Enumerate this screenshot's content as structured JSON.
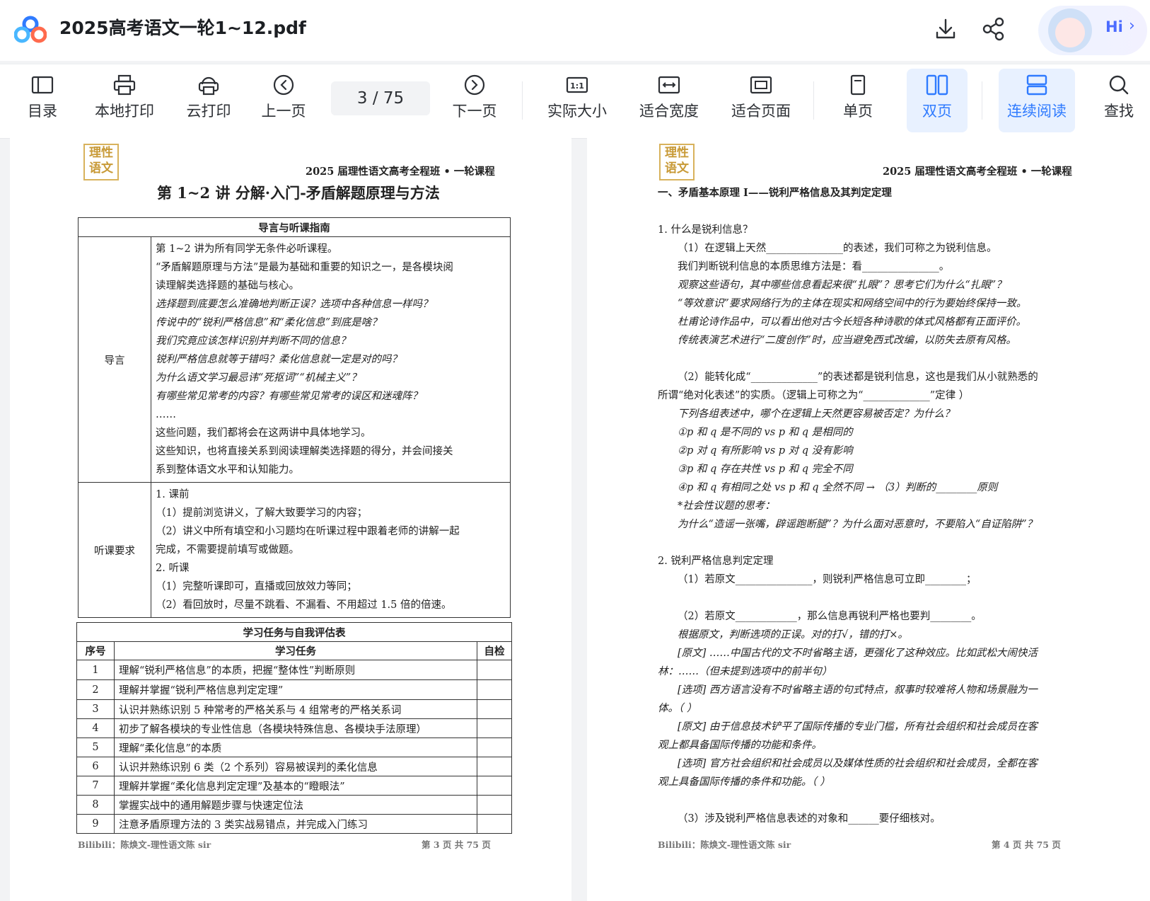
{
  "app": {
    "file_title": "2025高考语文一轮1~12.pdf",
    "hi_label": "Hi",
    "accent": "#2f7bff"
  },
  "toolbar": {
    "tools_left": [
      {
        "label": "目录",
        "icon": "toc-icon"
      },
      {
        "label": "本地打印",
        "icon": "printer-icon"
      },
      {
        "label": "云打印",
        "icon": "cloud-print-icon"
      },
      {
        "label": "上一页",
        "icon": "prev-page-icon"
      }
    ],
    "page_current": "3",
    "page_total": "/ 75",
    "tools_right": [
      {
        "label": "下一页",
        "icon": "next-page-icon"
      },
      {
        "label": "实际大小",
        "icon": "actual-size-icon"
      },
      {
        "label": "适合宽度",
        "icon": "fit-width-icon"
      },
      {
        "label": "适合页面",
        "icon": "fit-page-icon"
      },
      {
        "label": "单页",
        "icon": "single-page-icon"
      },
      {
        "label": "双页",
        "icon": "double-page-icon",
        "active": true
      },
      {
        "label": "连续阅读",
        "icon": "continuous-read-icon",
        "active": true
      },
      {
        "label": "查找",
        "icon": "search-icon"
      }
    ]
  },
  "left_page": {
    "stamp": "理性语文",
    "course": "2025 届理性语文高考全程班 • 一轮课程",
    "lecture_title": "第 1~2 讲 分解·入门-矛盾解题原理与方法",
    "guide": {
      "header": "导言与听课指南",
      "intro_label": "导言",
      "intro_lines": [
        "第 1~2 讲为所有同学无条件必听课程。",
        "“矛盾解题原理与方法”是最为基础和重要的知识之一，是各模块阅",
        "读理解类选择题的基础与核心。",
        "选择题到底要怎么准确地判断正误？选项中各种信息一样吗？",
        "传说中的“锐利严格信息”和“柔化信息”到底是啥？",
        "我们究竟应该怎样识别并判断不同的信息？",
        "锐利严格信息就等于错吗？柔化信息就一定是对的吗？",
        "为什么语文学习最忌讳“死抠词”“机械主义”？",
        "有哪些常见常考的内容？有哪些常见常考的误区和迷魂阵？",
        "……",
        "这些问题，我们都将会在这两讲中具体地学习。",
        "这些知识，也将直接关系到阅读理解类选择题的得分，并会间接关",
        "系到整体语文水平和认知能力。"
      ],
      "req_label": "听课要求",
      "req_lines": [
        "1. 课前",
        "（1）提前浏览讲义，了解大致要学习的内容；",
        "（2）讲义中所有填空和小习题均在听课过程中跟着老师的讲解一起",
        "完成，不需要提前填写或做题。",
        "2. 听课",
        "（1）完整听课即可，直播或回放效力等同；",
        "（2）看回放时，尽量不跳看、不漏看、不用超过 1.5 倍的倍速。"
      ]
    },
    "tasks": {
      "header": "学习任务与自我评估表",
      "col_no": "序号",
      "col_task": "学习任务",
      "col_check": "自检",
      "rows": [
        {
          "no": "1",
          "task": "理解“锐利严格信息”的本质，把握“整体性”判断原则"
        },
        {
          "no": "2",
          "task": "理解并掌握“锐利严格信息判定定理”"
        },
        {
          "no": "3",
          "task": "认识并熟练识别 5 种常考的严格关系与 4 组常考的严格关系词"
        },
        {
          "no": "4",
          "task": "初步了解各模块的专业性信息（各模块特殊信息、各模块手法原理）"
        },
        {
          "no": "5",
          "task": "理解“柔化信息”的本质"
        },
        {
          "no": "6",
          "task": "认识并熟练识别 6 类（2 个系列）容易被误判的柔化信息"
        },
        {
          "no": "7",
          "task": "理解并掌握“柔化信息判定定理”及基本的“瞪眼法”"
        },
        {
          "no": "8",
          "task": "掌握实战中的通用解题步骤与快速定位法"
        },
        {
          "no": "9",
          "task": "注意矛盾原理方法的 3 类实战易错点，并完成入门练习"
        }
      ]
    },
    "footer_left": "Bilibili：陈焕文-理性语文陈 sir",
    "footer_right": "第 3 页 共 75 页"
  },
  "right_page": {
    "stamp": "理性语文",
    "course": "2025 届理性语文高考全程班 • 一轮课程",
    "section_title": "一、矛盾基本原理 I——锐利严格信息及其判定定理",
    "lines": [
      {
        "t": "1. 什么是锐利信息？"
      },
      {
        "t": "（1）在逻辑上天然_______________的表述，我们可称之为锐利信息。",
        "indent": true
      },
      {
        "t": "我们判断锐利信息的本质思维方法是：看_______________。",
        "indent": true
      },
      {
        "t": "观察这些语句，其中哪些信息看起来很“扎眼”？思考它们为什么“扎眼”？",
        "indent": true,
        "italic": true
      },
      {
        "t": "“等效意识”要求网络行为的主体在现实和网络空间中的行为要始终保持一致。",
        "indent": true,
        "italic": true
      },
      {
        "t": "杜甫论诗作品中，可以看出他对古今长短各种诗歌的体式风格都有正面评价。",
        "indent": true,
        "italic": true
      },
      {
        "t": "传统表演艺术进行“二度创作”时，应当避免西式改编，以防失去原有风格。",
        "indent": true,
        "italic": true
      },
      {
        "t": "（2）能转化成“_____________”的表述都是锐利信息，这也是我们从小就熟悉的",
        "indent": true
      },
      {
        "t": "所谓“绝对化表述”的实质。（逻辑上可称之为“_____________”定律 ）"
      },
      {
        "t": "下列各组表述中，哪个在逻辑上天然更容易被否定？为什么？",
        "indent": true,
        "italic": true
      },
      {
        "t": "①p 和 q 是不同的        vs        p 和 q 是相同的",
        "indent": true,
        "italic": true
      },
      {
        "t": "②p 对 q 有所影响        vs        p 对 q 没有影响",
        "indent": true,
        "italic": true
      },
      {
        "t": "③p 和 q 存在共性        vs        p 和 q 完全不同",
        "indent": true,
        "italic": true
      },
      {
        "t": "④p 和 q 有相同之处      vs        p 和 q 全然不同 → （3）判断的________原则",
        "indent": true,
        "italic": true
      },
      {
        "t": "*社会性议题的思考：",
        "indent": true,
        "italic": true
      },
      {
        "t": "为什么“造谣一张嘴，辟谣跑断腿”？为什么面对恶意时，不要陷入“自证陷阱”？",
        "indent": true,
        "italic": true
      },
      {
        "t": "2. 锐利严格信息判定定理"
      },
      {
        "t": "（1）若原文_______________，则锐利严格信息可立即________；",
        "indent": true
      },
      {
        "t": "（2）若原文____________，那么信息再锐利严格也要判________。",
        "indent": true
      },
      {
        "t": "根据原文，判断选项的正误。对的打√，错的打×。",
        "indent": true,
        "italic": true
      },
      {
        "t": "[原文] ……中国古代的文不时省略主语，更强化了这种效应。比如武松大闹快活",
        "indent": true,
        "italic": true
      },
      {
        "t": "林：……（但未提到选项中的前半句）",
        "italic": true
      },
      {
        "t": "[选项] 西方语言没有不时省略主语的句式特点，叙事时较难将人物和场景融为一",
        "indent": true,
        "italic": true
      },
      {
        "t": "体。（   ）",
        "italic": true
      },
      {
        "t": "[原文] 由于信息技术铲平了国际传播的专业门槛，所有社会组织和社会成员在客",
        "indent": true,
        "italic": true
      },
      {
        "t": "观上都具备国际传播的功能和条件。",
        "italic": true
      },
      {
        "t": "[选项] 官方社会组织和社会成员以及媒体性质的社会组织和社会成员，全都在客",
        "indent": true,
        "italic": true
      },
      {
        "t": "观上具备国际传播的条件和功能。（    ）",
        "italic": true
      },
      {
        "t": "（3）涉及锐利严格信息表述的对象和______要仔细核对。",
        "indent": true
      }
    ],
    "footer_left": "Bilibili：陈焕文-理性语文陈 sir",
    "footer_right": "第 4 页 共 75 页"
  }
}
